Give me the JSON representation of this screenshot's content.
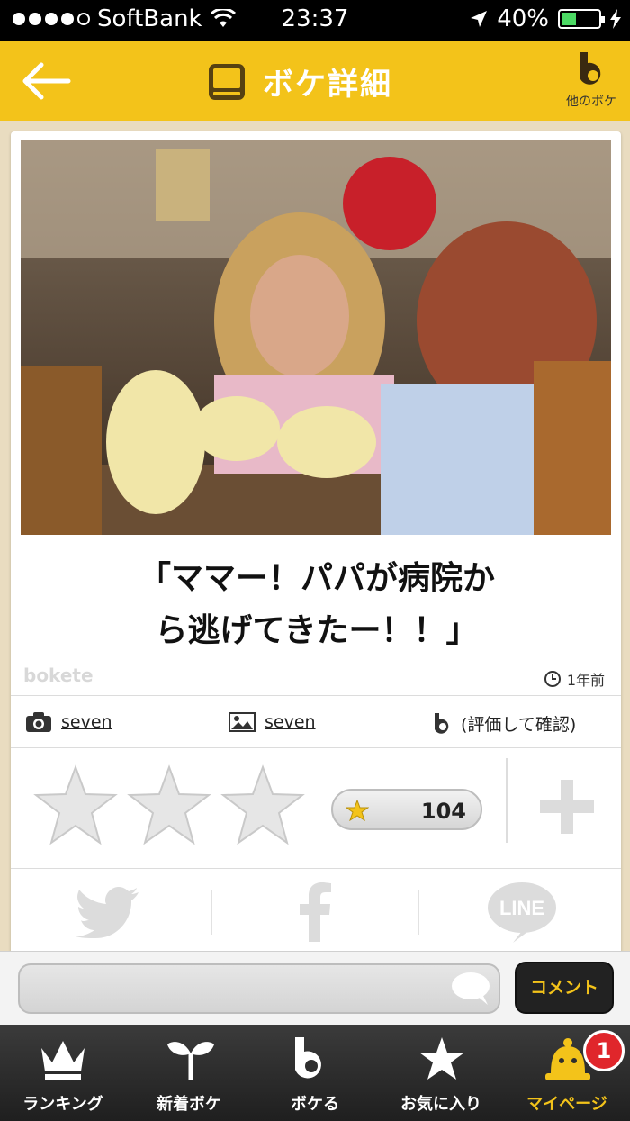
{
  "status_bar": {
    "carrier": "SoftBank",
    "time": "23:37",
    "battery": "40%"
  },
  "header": {
    "title": "ボケ詳細",
    "other_label": "他のボケ"
  },
  "post": {
    "caption_line1": "「ママー！パパが病院か",
    "caption_line2": "ら逃げてきたー！！」",
    "brand": "bokete",
    "time_ago": "1年前",
    "author": "seven",
    "photo_author": "seven",
    "rating_note": "(評価して確認)",
    "star_count": "104"
  },
  "share": {
    "line_label": "LINE"
  },
  "comment": {
    "placeholder": "",
    "button": "コメント"
  },
  "tabs": [
    {
      "label": "ランキング"
    },
    {
      "label": "新着ボケ"
    },
    {
      "label": "ボケる"
    },
    {
      "label": "お気に入り"
    },
    {
      "label": "マイページ"
    }
  ],
  "badge": "1",
  "colors": {
    "accent": "#f3c31a",
    "tabbar": "#2a2a2a",
    "badge": "#e0262b"
  }
}
